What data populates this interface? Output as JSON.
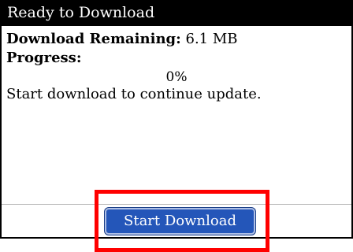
{
  "window": {
    "title": "Ready to Download"
  },
  "details": {
    "download_remaining_label": "Download Remaining:",
    "download_remaining_value": "6.1 MB",
    "progress_label": "Progress:",
    "progress_percent": "0%",
    "progress_value": 0,
    "message": "Start download to continue update."
  },
  "actions": {
    "start_download_label": "Start Download"
  },
  "colors": {
    "titlebar_bg": "#000000",
    "button_bg": "#2456b9",
    "highlight": "#ff0000"
  }
}
